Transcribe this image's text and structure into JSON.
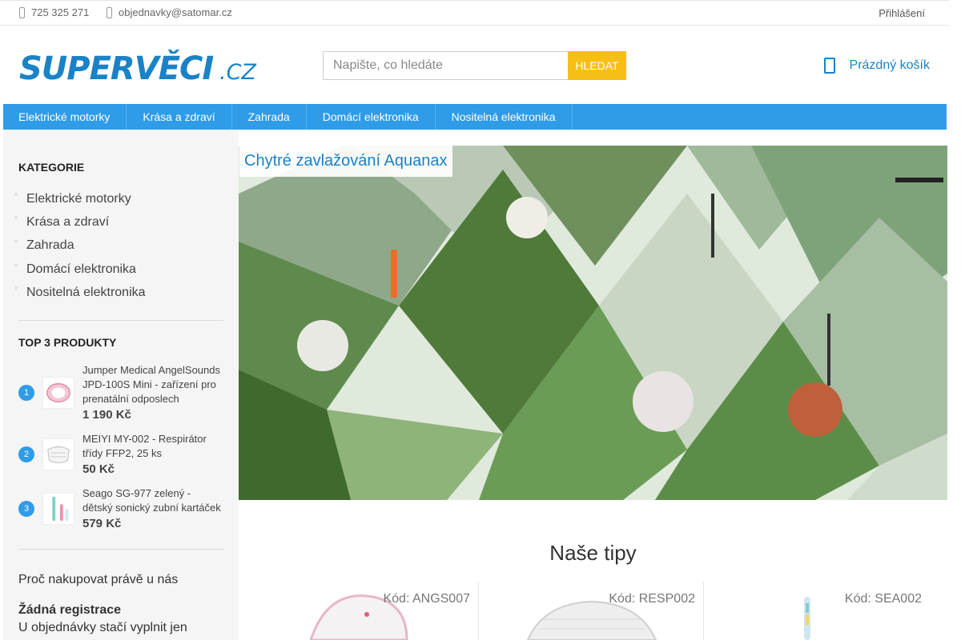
{
  "topbar": {
    "phone": "725 325 271",
    "email": "objednavky@satomar.cz",
    "login": "Přihlášení"
  },
  "header": {
    "logo_main": "SUPERVĚCI",
    "logo_tld": ".CZ",
    "search_placeholder": "Napište, co hledáte",
    "search_button": "HLEDAT",
    "cart_label": "Prázdný košík"
  },
  "nav": {
    "items": [
      "Elektrické motorky",
      "Krása a zdraví",
      "Zahrada",
      "Domácí elektronika",
      "Nositelná elektronika"
    ]
  },
  "sidebar": {
    "categories_heading": "KATEGORIE",
    "categories": [
      "Elektrické motorky",
      "Krása a zdraví",
      "Zahrada",
      "Domácí elektronika",
      "Nositelná elektronika"
    ],
    "top_heading": "TOP 3 PRODUKTY",
    "top_products": [
      {
        "rank": "1",
        "name": "Jumper Medical AngelSounds JPD-100S Mini - zařízení pro prenatální odposlech",
        "price": "1 190 Kč"
      },
      {
        "rank": "2",
        "name": "MEIYI MY-002 - Respirátor třídy FFP2, 25 ks",
        "price": "50 Kč"
      },
      {
        "rank": "3",
        "name": "Seago SG-977 zelený - dětský sonický zubní kartáček",
        "price": "579 Kč"
      }
    ],
    "why_heading": "Proč nakupovat právě u nás",
    "benefit_title": "Žádná registrace",
    "benefit_text": "U objednávky stačí vyplnit jen"
  },
  "banner": {
    "caption": "Chytré zavlažování Aquanax"
  },
  "tips": {
    "title": "Naše tipy",
    "cards": [
      {
        "code": "Kód: ANGS007"
      },
      {
        "code": "Kód: RESP002"
      },
      {
        "code": "Kód: SEA002"
      }
    ]
  },
  "colors": {
    "brand_blue": "#1a82c6",
    "nav_blue": "#2e9ce8",
    "search_button": "#f7bf16"
  },
  "icons": [
    "phone-icon",
    "email-icon",
    "cart-icon"
  ]
}
